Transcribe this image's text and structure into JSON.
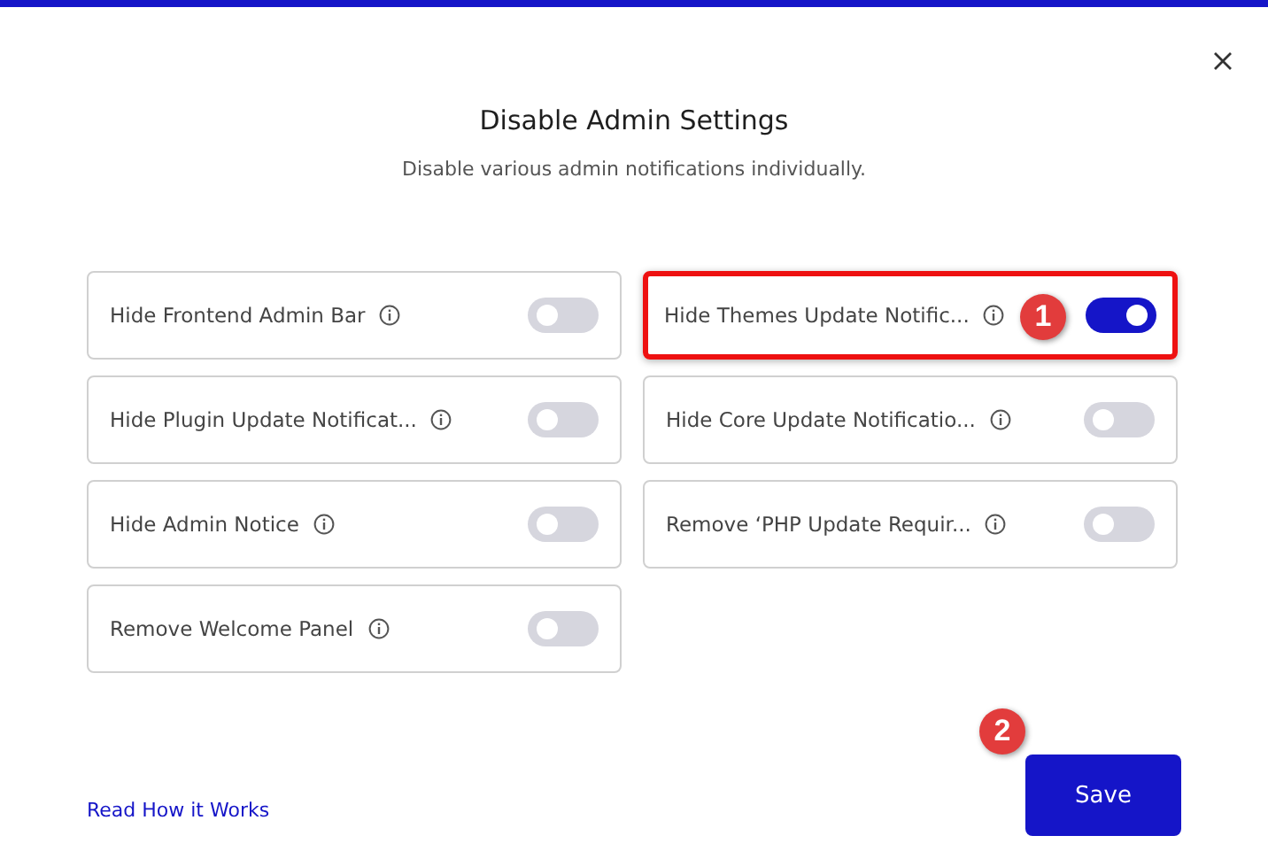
{
  "dialog": {
    "title": "Disable Admin Settings",
    "subtitle": "Disable various admin notifications individually."
  },
  "settings": [
    {
      "label": "Hide Frontend Admin Bar",
      "on": false,
      "highlighted": false
    },
    {
      "label": "Hide Themes Update Notific...",
      "on": true,
      "highlighted": true,
      "annotation": "1"
    },
    {
      "label": "Hide Plugin Update Notificat...",
      "on": false,
      "highlighted": false
    },
    {
      "label": "Hide Core Update Notificatio...",
      "on": false,
      "highlighted": false
    },
    {
      "label": "Hide Admin Notice",
      "on": false,
      "highlighted": false
    },
    {
      "label": "Remove ‘PHP Update Requir...",
      "on": false,
      "highlighted": false
    },
    {
      "label": "Remove Welcome Panel",
      "on": false,
      "highlighted": false
    }
  ],
  "footer": {
    "link": "Read How it Works",
    "save": {
      "label": "Save",
      "annotation": "2"
    }
  }
}
